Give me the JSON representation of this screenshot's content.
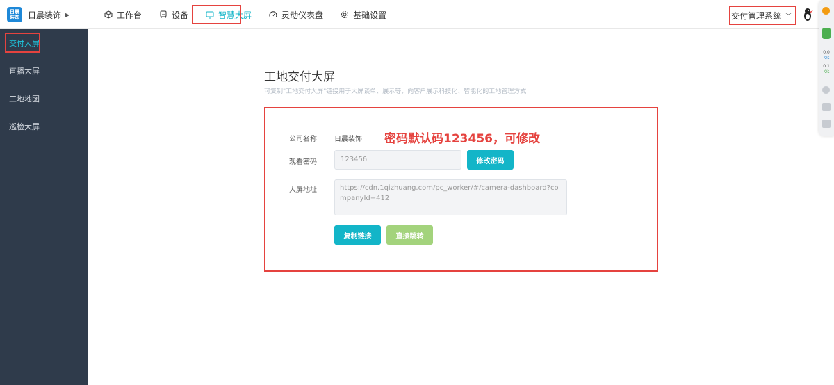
{
  "brand": {
    "logo_text": "日晨装饰",
    "name": "日晨装饰"
  },
  "nav": [
    {
      "label": "工作台",
      "icon": "cube-icon"
    },
    {
      "label": "设备",
      "icon": "device-icon"
    },
    {
      "label": "智慧大屏",
      "icon": "monitor-icon",
      "active": true
    },
    {
      "label": "灵动仪表盘",
      "icon": "gauge-icon"
    },
    {
      "label": "基础设置",
      "icon": "gear-icon"
    }
  ],
  "system_select": {
    "label": "交付管理系统"
  },
  "sidebar": {
    "items": [
      {
        "label": "交付大屏",
        "active": true
      },
      {
        "label": "直播大屏"
      },
      {
        "label": "工地地图"
      },
      {
        "label": "巡检大屏"
      }
    ]
  },
  "page": {
    "title": "工地交付大屏",
    "subtitle": "可复制\"工地交付大屏\"链接用于大屏谈单、展示等，向客户展示科技化、智能化的工地管理方式"
  },
  "form": {
    "company_label": "公司名称",
    "company_value": "日晨装饰",
    "password_label": "观看密码",
    "password_value": "123456",
    "change_password_button": "修改密码",
    "url_label": "大屏地址",
    "url_value": "https://cdn.1qizhuang.com/pc_worker/#/camera-dashboard?companyId=412",
    "copy_button": "复制链接",
    "jump_button": "直接跳转"
  },
  "annotation": "密码默认码123456，可修改",
  "float_toolbar": {
    "speed_up": "0.0",
    "speed_down": "0.1",
    "unit": "K/s"
  },
  "colors": {
    "accent": "#13b5c8",
    "highlight": "#e5433f",
    "sidebar_bg": "#2f3b4b",
    "green_button": "#a3d37c"
  }
}
